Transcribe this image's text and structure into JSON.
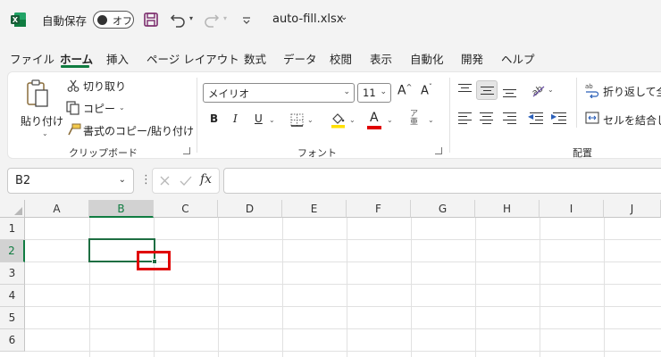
{
  "title_bar": {
    "autosave_label": "自動保存",
    "autosave_state": "オフ",
    "filename": "auto-fill.xlsx"
  },
  "menu": {
    "tabs": [
      "ファイル",
      "ホーム",
      "挿入",
      "ページ レイアウト",
      "数式",
      "データ",
      "校閲",
      "表示",
      "自動化",
      "開発",
      "ヘルプ"
    ],
    "active_tab": "ホーム"
  },
  "ribbon": {
    "clipboard": {
      "paste_label": "貼り付け",
      "cut_label": "切り取り",
      "copy_label": "コピー",
      "format_painter_label": "書式のコピー/貼り付け",
      "group_label": "クリップボード"
    },
    "font": {
      "font_name": "メイリオ",
      "font_size": "11",
      "bold": "B",
      "italic": "I",
      "underline": "U",
      "font_color_letter": "A",
      "group_label": "フォント"
    },
    "alignment": {
      "wrap_text_label": "折り返して全体",
      "merge_label": "セルを結合して",
      "group_label": "配置"
    }
  },
  "formula_bar": {
    "name_box": "B2",
    "fx_label": "fx",
    "formula_value": ""
  },
  "sheet": {
    "columns": [
      "A",
      "B",
      "C",
      "D",
      "E",
      "F",
      "G",
      "H",
      "I",
      "J"
    ],
    "rows": [
      "1",
      "2",
      "3",
      "4",
      "5",
      "6"
    ],
    "selected_cell": "B2",
    "selected_column": "B",
    "selected_row": "2"
  },
  "colors": {
    "accent_green": "#107c41",
    "selection_border": "#1e6e42",
    "callout_red": "#e00000"
  }
}
